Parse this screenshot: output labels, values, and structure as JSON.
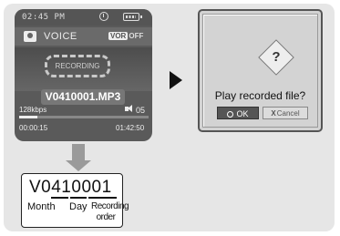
{
  "device": {
    "status": {
      "time": "02:45 PM",
      "clock_icon": "clock-icon",
      "battery_icon": "battery-icon"
    },
    "mode": {
      "icon": "mic-icon",
      "label": "VOICE",
      "vor_on": "VOR",
      "vor_off": "OFF"
    },
    "recording_label": "RECORDING",
    "filename": "V0410001.MP3",
    "bitrate": "128kbps",
    "volume": "05",
    "elapsed": "00:00:15",
    "remaining": "01:42:50",
    "progress_fraction": 0.14
  },
  "breakdown": {
    "code": "V0410001",
    "month_label": "Month",
    "day_label": "Day",
    "order_label": "Recording order"
  },
  "dialog": {
    "icon": "question-icon",
    "icon_glyph": "?",
    "prompt": "Play recorded file?",
    "ok_label": "OK",
    "cancel_mark": "X",
    "cancel_label": "Cancel"
  },
  "colors": {
    "screen_bg": "#5a5a5a",
    "panel_bg": "#e6e6e6",
    "dialog_bg": "#d3d3d3"
  }
}
